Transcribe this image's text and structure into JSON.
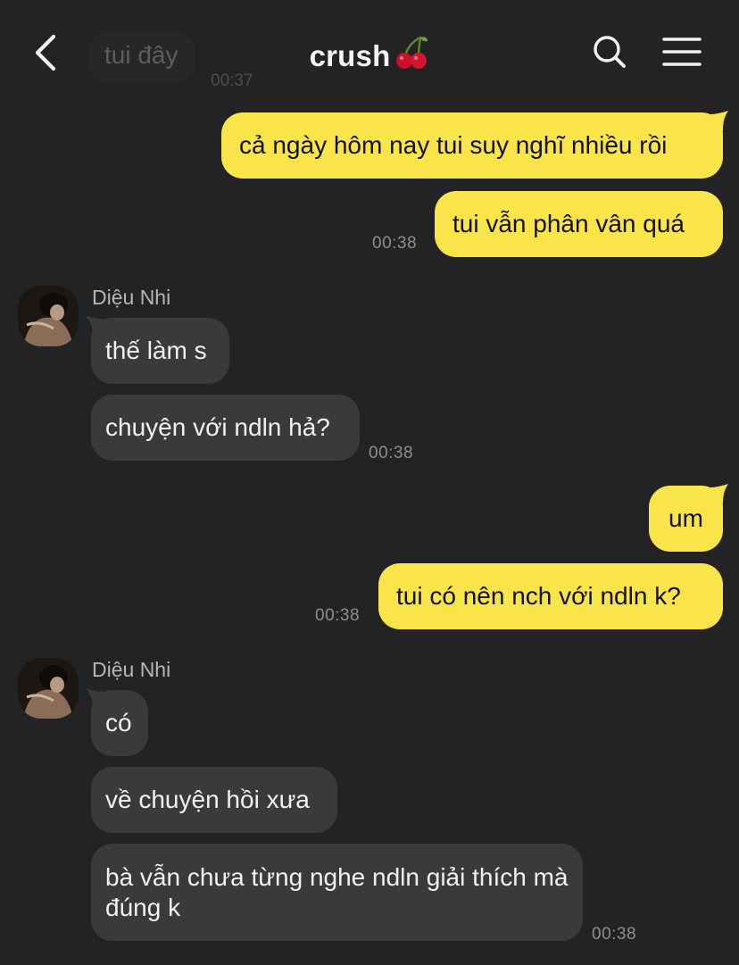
{
  "header": {
    "title": "crush",
    "title_emoji": "cherry",
    "back_icon": "chevron-left-icon",
    "search_icon": "search-icon",
    "menu_icon": "menu-icon"
  },
  "previous_message": {
    "text": "tui đây",
    "time": "00:37"
  },
  "colors": {
    "background": "#232325",
    "outgoing_bubble": "#f9e54a",
    "incoming_bubble": "#3a3a3d",
    "timestamp": "#8d8d92",
    "sender_name": "#b5b5ba"
  },
  "messages": [
    {
      "from": "me",
      "text": "cả ngày hôm nay tui suy nghĩ nhiều rồi"
    },
    {
      "from": "me",
      "text": "tui vẫn phân vân quá",
      "time": "00:38"
    },
    {
      "from": "them",
      "sender": "Diệu Nhi",
      "text": "thế làm s"
    },
    {
      "from": "them",
      "text": "chuyện với ndln hả?",
      "time": "00:38"
    },
    {
      "from": "me",
      "text": "um"
    },
    {
      "from": "me",
      "text": "tui có nên nch với ndln k?",
      "time": "00:38"
    },
    {
      "from": "them",
      "sender": "Diệu Nhi",
      "text": "có"
    },
    {
      "from": "them",
      "text": "về chuyện hồi xưa"
    },
    {
      "from": "them",
      "text": "bà vẫn chưa từng nghe ndln giải thích mà đúng k",
      "time": "00:38"
    }
  ]
}
